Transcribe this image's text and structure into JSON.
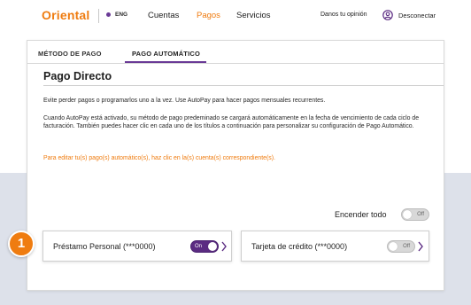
{
  "nav": {
    "logo": "Oriental",
    "language": "ENG",
    "links": [
      "Cuentas",
      "Pagos",
      "Servicios"
    ],
    "opinion": "Danos tu opinión",
    "logout": "Desconectar"
  },
  "tabs": [
    "MÉTODO DE PAGO",
    "PAGO AUTOMÁTICO"
  ],
  "section": {
    "title": "Pago Directo",
    "p1": "Evite perder pagos o programarlos uno a la vez. Use AutoPay para hacer pagos mensuales recurrentes.",
    "p2": "Cuando AutoPay está activado, su método de pago predeminado se cargará automáticamente en la fecha de vencimiento de cada ciclo de facturación. También puedes hacer clic en cada uno de los títulos a continuación para personalizar su configuración de Pago Automático.",
    "p3": "Para editar tu(s) pago(s) automático(s), haz clic en la(s) cuenta(s) correspondiente(s)."
  },
  "master_toggle": {
    "label": "Encender todo",
    "state": "Off"
  },
  "accounts": [
    {
      "label": "Préstamo Personal (***0000)",
      "state": "On"
    },
    {
      "label": "Tarjeta de crédito (***0000)",
      "state": "Off"
    }
  ],
  "step_badge": "1",
  "colors": {
    "brand_orange": "#ef7c10",
    "brand_purple": "#5b2b82",
    "band": "#dde1ea"
  }
}
